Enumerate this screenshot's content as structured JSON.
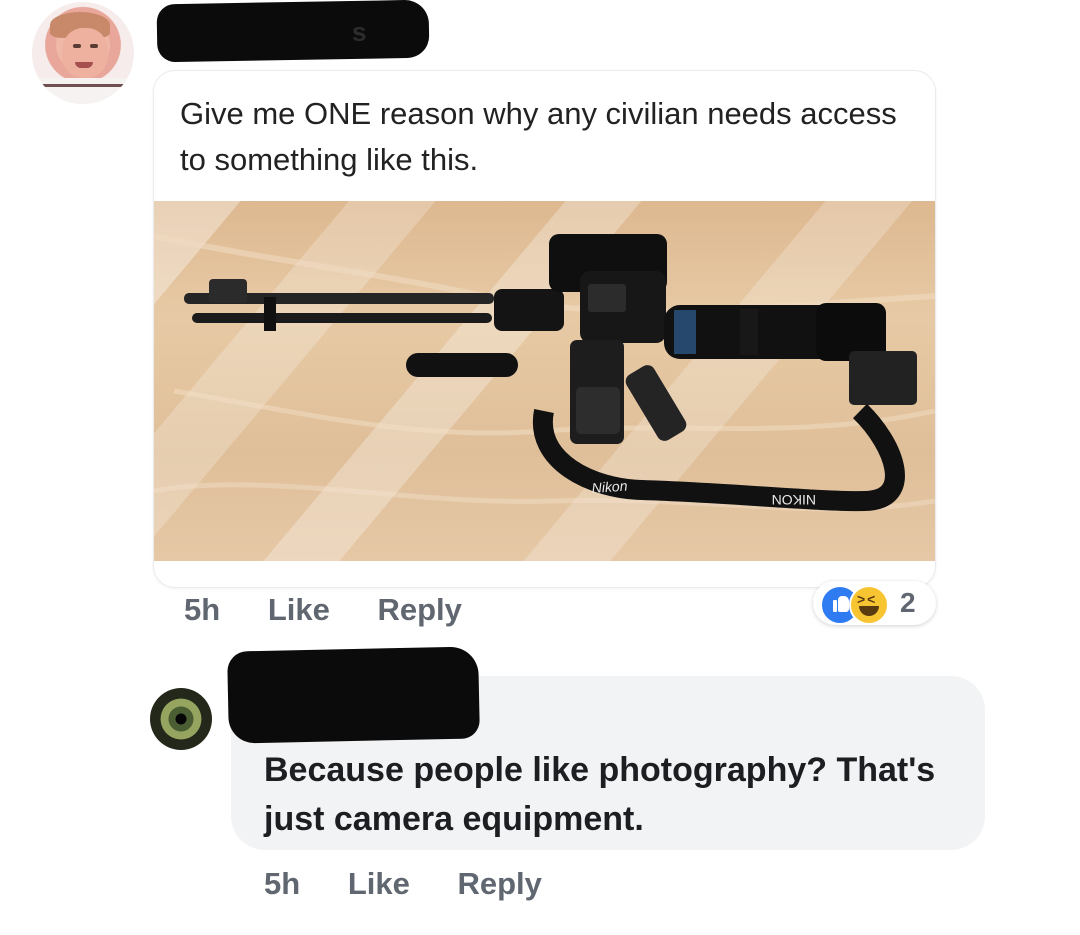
{
  "post": {
    "text": "Give me ONE reason why any civilian needs access to something like this.",
    "time": "5h",
    "like": "Like",
    "reply": "Reply",
    "reaction_count": "2"
  },
  "image": {
    "strap_text_left": "Nikon",
    "strap_text_right": "NIKON"
  },
  "reply_comment": {
    "text": "Because people like photography? That's just camera equipment.",
    "time": "5h",
    "like": "Like",
    "reply": "Reply"
  },
  "icons": [
    "like-icon",
    "laugh-icon"
  ]
}
